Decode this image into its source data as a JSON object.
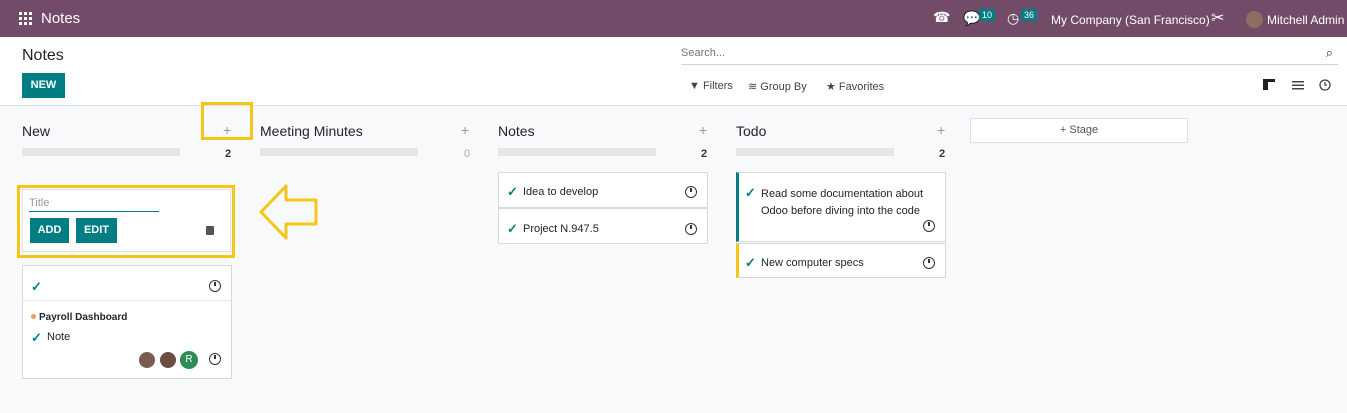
{
  "topbar": {
    "app_title": "Notes",
    "badge_messages": "10",
    "badge_activities": "36",
    "company": "My Company (San Francisco)",
    "user": "Mitchell Admin"
  },
  "control": {
    "breadcrumb": "Notes",
    "new_label": "NEW",
    "search_placeholder": "Search...",
    "filters": "Filters",
    "group_by": "Group By",
    "favorites": "Favorites"
  },
  "columns": [
    {
      "title": "New",
      "count": "2"
    },
    {
      "title": "Meeting Minutes",
      "count": "0"
    },
    {
      "title": "Notes",
      "count": "2"
    },
    {
      "title": "Todo",
      "count": "2"
    }
  ],
  "stage_label": "Stage",
  "quick_create": {
    "placeholder": "Title",
    "add": "ADD",
    "edit": "EDIT"
  },
  "cards": {
    "new_tag": "Payroll Dashboard",
    "new_note": "Note",
    "new_avatar_letter": "R",
    "notes": [
      "Idea to develop",
      "Project N.947.5"
    ],
    "todo": [
      "Read some documentation about Odoo before diving into the code",
      "New computer specs"
    ]
  },
  "colors": {
    "brand": "#714b67",
    "accent": "#017e84",
    "highlight": "#f5c518"
  }
}
